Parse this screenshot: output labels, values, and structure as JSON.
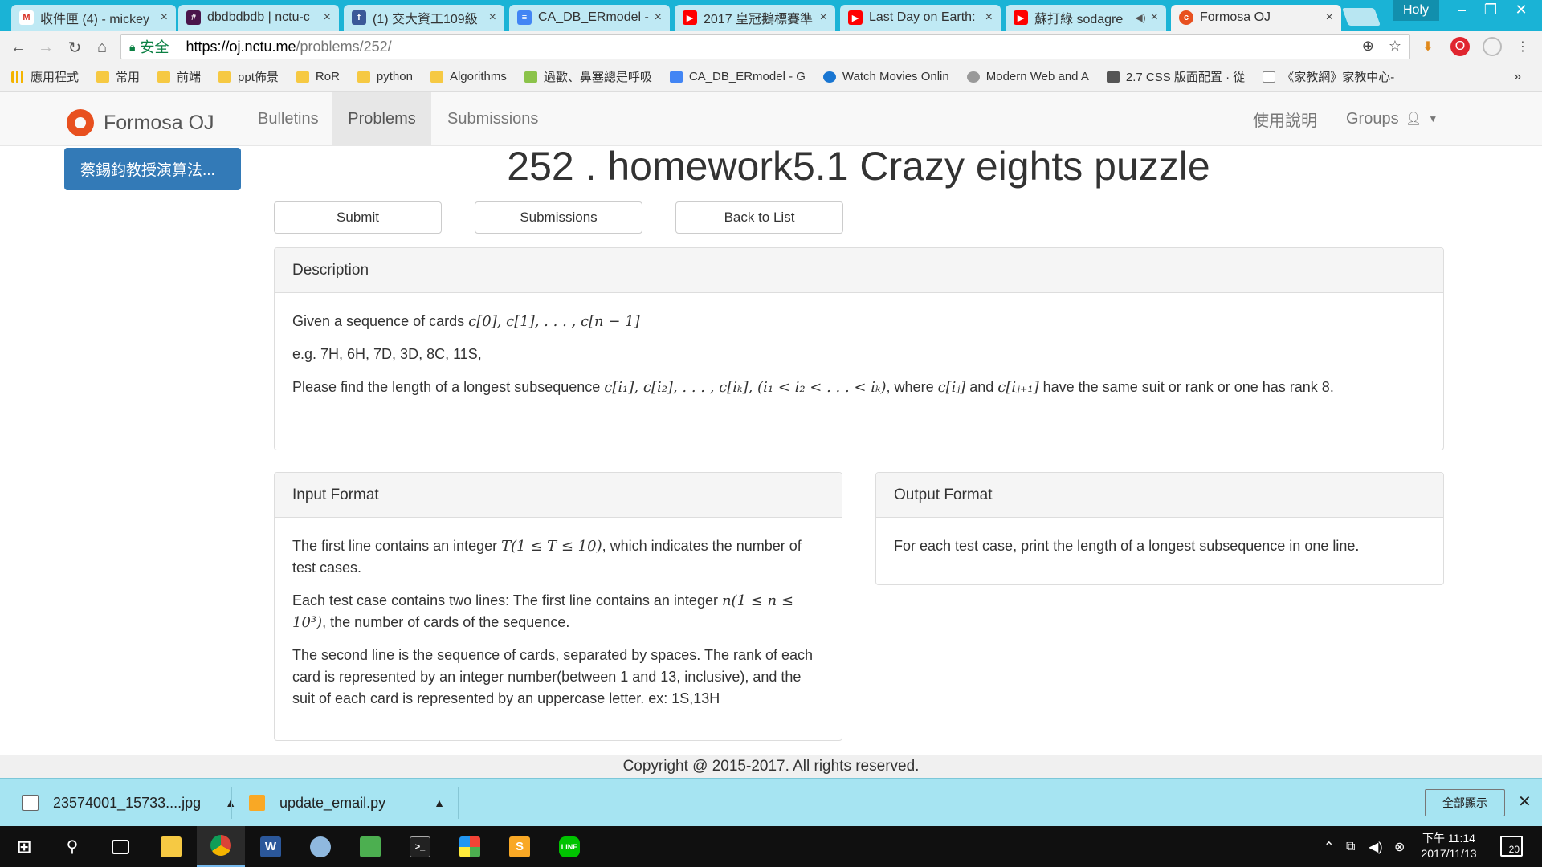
{
  "browser": {
    "tabs": [
      {
        "title": "收件匣 (4) - mickey",
        "icon": "gmail-icon",
        "color": "#d93025"
      },
      {
        "title": "dbdbdbdb | nctu-c",
        "icon": "slack-icon",
        "color": "#4a154b"
      },
      {
        "title": "(1) 交大資工109級",
        "icon": "facebook-icon",
        "color": "#3b5998"
      },
      {
        "title": "CA_DB_ERmodel -",
        "icon": "docs-icon",
        "color": "#4285f4"
      },
      {
        "title": "2017 皇冠鵝標賽準",
        "icon": "youtube-icon",
        "color": "#ff0000"
      },
      {
        "title": "Last Day on Earth:",
        "icon": "youtube-icon",
        "color": "#ff0000"
      },
      {
        "title": "蘇打綠 sodagre",
        "icon": "youtube-icon",
        "color": "#ff0000"
      },
      {
        "title": "Formosa OJ",
        "icon": "formosa-oj-icon",
        "color": "#e8501f"
      }
    ],
    "window_user": "Holy",
    "address": {
      "secure_label": "安全",
      "host": "https://oj.nctu.me",
      "path": "/problems/252/"
    },
    "bookmarks": [
      {
        "label": "應用程式",
        "icon": "apps-icon"
      },
      {
        "label": "常用",
        "icon": "folder-icon"
      },
      {
        "label": "前端",
        "icon": "folder-icon"
      },
      {
        "label": "ppt佈景",
        "icon": "folder-icon"
      },
      {
        "label": "RoR",
        "icon": "folder-icon"
      },
      {
        "label": "python",
        "icon": "folder-icon"
      },
      {
        "label": "Algorithms",
        "icon": "folder-icon"
      },
      {
        "label": "過歡、鼻塞總是呼吸",
        "icon": "page-icon"
      },
      {
        "label": "CA_DB_ERmodel - G",
        "icon": "docs-icon"
      },
      {
        "label": "Watch Movies Onlin",
        "icon": "play-icon"
      },
      {
        "label": "Modern Web and A",
        "icon": "globe-icon"
      },
      {
        "label": "2.7 CSS 版面配置 · 從",
        "icon": "book-icon"
      },
      {
        "label": "《家教網》家教中心-",
        "icon": "page-icon"
      }
    ]
  },
  "site": {
    "brand": "Formosa OJ",
    "nav": {
      "bulletins": "Bulletins",
      "problems": "Problems",
      "submissions": "Submissions",
      "help": "使用說明",
      "groups": "Groups"
    },
    "course_button": "蔡錫鈞教授演算法...",
    "problem": {
      "title": "252 . homework5.1 Crazy eights puzzle",
      "buttons": {
        "submit": "Submit",
        "submissions": "Submissions",
        "back": "Back to List"
      },
      "description": {
        "heading": "Description",
        "line1_text": "Given a sequence of cards ",
        "line1_math": "c[0], c[1], . . . , c[n − 1]",
        "line2": "e.g. 7H, 6H, 7D, 3D, 8C, 11S,",
        "line3_a": "Please find the length of a longest subsequence ",
        "line3_math1": "c[i₁], c[i₂], . . . , c[iₖ], (i₁ < i₂ < . . . < iₖ)",
        "line3_b": ", where ",
        "line3_math2": "c[iⱼ]",
        "line3_c": " and ",
        "line3_math3": "c[iⱼ₊₁]",
        "line3_d": " have the same suit or rank or one has rank 8."
      },
      "input_format": {
        "heading": "Input Format",
        "p1_a": "The first line contains an integer ",
        "p1_math": "T(1 ≤ T ≤ 10)",
        "p1_b": ", which indicates the number of test cases.",
        "p2_a": "Each test case contains two lines: The first line contains an integer ",
        "p2_math": "n(1 ≤ n ≤ 10³)",
        "p2_b": ", the number of cards of the sequence.",
        "p3": "The second line is the sequence of cards, separated by spaces. The rank of each card is represented by an integer number(between 1 and 13, inclusive), and the suit of each card is represented by an uppercase letter. ex: 1S,13H"
      },
      "output_format": {
        "heading": "Output Format",
        "p1": "For each test case, print the length of a longest subsequence in one line."
      }
    },
    "footer": "Copyright @ 2015-2017. All rights reserved."
  },
  "downloads": {
    "items": [
      {
        "name": "23574001_15733....jpg",
        "icon": "image-file-icon"
      },
      {
        "name": "update_email.py",
        "icon": "sublime-file-icon"
      }
    ],
    "show_all": "全部顯示"
  },
  "taskbar": {
    "clock_time": "下午 11:14",
    "clock_date": "2017/11/13",
    "notification_count": "20"
  }
}
